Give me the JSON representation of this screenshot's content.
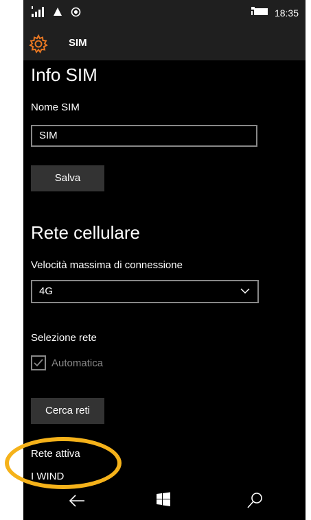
{
  "status_bar": {
    "time": "18:35"
  },
  "header": {
    "title": "SIM"
  },
  "sim_info": {
    "heading": "Info SIM",
    "name_label": "Nome SIM",
    "name_value": "SIM",
    "save_label": "Salva"
  },
  "cellular": {
    "heading": "Rete cellulare",
    "speed_label": "Velocità massima di connessione",
    "speed_value": "4G",
    "network_selection_label": "Selezione rete",
    "automatic_label": "Automatica",
    "automatic_checked": true,
    "search_label": "Cerca reti",
    "active_network_label": "Rete attiva",
    "active_network_value": "I WIND"
  },
  "colors": {
    "accent": "#e87722",
    "highlight": "#f5b21a"
  }
}
